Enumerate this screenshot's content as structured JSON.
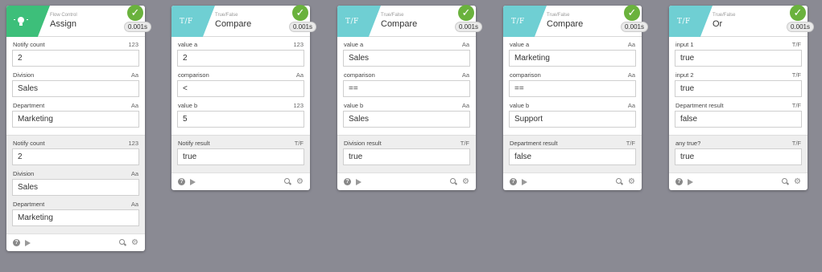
{
  "cards": [
    {
      "category": "Flow Control",
      "title": "Assign",
      "timing": "0.001s",
      "badge_color": "#3dbf7a",
      "icon": "lightbulb-icon",
      "input_fields": [
        {
          "label": "Notify count",
          "type": "123",
          "value": "2"
        },
        {
          "label": "Division",
          "type": "Aa",
          "value": "Sales"
        },
        {
          "label": "Department",
          "type": "Aa",
          "value": "Marketing"
        }
      ],
      "output_fields": [
        {
          "label": "Notify count",
          "type": "123",
          "value": "2"
        },
        {
          "label": "Division",
          "type": "Aa",
          "value": "Sales"
        },
        {
          "label": "Department",
          "type": "Aa",
          "value": "Marketing"
        }
      ]
    },
    {
      "category": "True/False",
      "title": "Compare",
      "timing": "0.001s",
      "badge_color": "#6fcfd3",
      "icon_text": "T/F",
      "input_fields": [
        {
          "label": "value a",
          "type": "123",
          "value": "2"
        },
        {
          "label": "comparison",
          "type": "Aa",
          "value": "<"
        },
        {
          "label": "value b",
          "type": "123",
          "value": "5"
        }
      ],
      "output_fields": [
        {
          "label": "Notify result",
          "type": "T/F",
          "value": "true"
        }
      ]
    },
    {
      "category": "True/False",
      "title": "Compare",
      "timing": "0.001s",
      "badge_color": "#6fcfd3",
      "icon_text": "T/F",
      "input_fields": [
        {
          "label": "value a",
          "type": "Aa",
          "value": "Sales"
        },
        {
          "label": "comparison",
          "type": "Aa",
          "value": "=="
        },
        {
          "label": "value b",
          "type": "Aa",
          "value": "Sales"
        }
      ],
      "output_fields": [
        {
          "label": "Division result",
          "type": "T/F",
          "value": "true"
        }
      ]
    },
    {
      "category": "True/False",
      "title": "Compare",
      "timing": "0.001s",
      "badge_color": "#6fcfd3",
      "icon_text": "T/F",
      "input_fields": [
        {
          "label": "value a",
          "type": "Aa",
          "value": "Marketing"
        },
        {
          "label": "comparison",
          "type": "Aa",
          "value": "=="
        },
        {
          "label": "value b",
          "type": "Aa",
          "value": "Support"
        }
      ],
      "output_fields": [
        {
          "label": "Department result",
          "type": "T/F",
          "value": "false"
        }
      ]
    },
    {
      "category": "True/False",
      "title": "Or",
      "timing": "0.001s",
      "badge_color": "#6fcfd3",
      "icon_text": "T/F",
      "input_fields": [
        {
          "label": "input 1",
          "type": "T/F",
          "value": "true"
        },
        {
          "label": "input 2",
          "type": "T/F",
          "value": "true"
        },
        {
          "label": "Department result",
          "type": "T/F",
          "value": "false"
        }
      ],
      "output_fields": [
        {
          "label": "any true?",
          "type": "T/F",
          "value": "true"
        }
      ]
    }
  ],
  "check_glyph": "✓",
  "help_glyph": "?",
  "gear_glyph": "⚙"
}
